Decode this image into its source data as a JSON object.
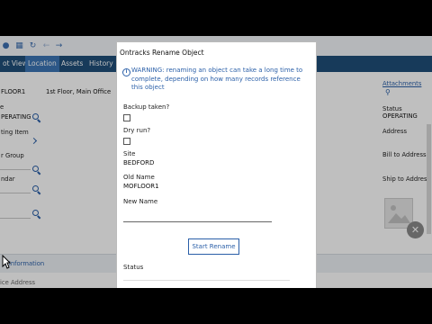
{
  "toolbar": {
    "icons": [
      "add-icon",
      "grid-icon",
      "copy-icon",
      "refresh-icon",
      "back-arrow-icon",
      "forward-arrow-icon"
    ]
  },
  "tabs": [
    {
      "label": "ot View",
      "active": false
    },
    {
      "label": "Location",
      "active": true
    },
    {
      "label": "Assets",
      "active": false
    },
    {
      "label": "History",
      "active": false
    }
  ],
  "left": {
    "location_value": "FLOOR1",
    "description_value": "1st Floor, Main Office",
    "type_label": "e",
    "status_value": "PERATING",
    "costing_label": "ting Item",
    "group_label": "r Group",
    "calendar_label": "ndar",
    "info_section": "t Information",
    "address_label": "ice Address"
  },
  "right": {
    "attachments_label": "Attachments",
    "status_label": "Status",
    "status_value": "OPERATING",
    "address_label": "Address",
    "bill_to_label": "Bill to Address",
    "ship_to_label": "Ship to Address"
  },
  "dialog": {
    "title": "Ontracks Rename Object",
    "warning": "WARNING: renaming an object can take a long time to complete, depending on how many records reference this object",
    "backup_label": "Backup taken?",
    "dry_run_label": "Dry run?",
    "site_label": "Site",
    "site_value": "BEDFORD",
    "old_name_label": "Old Name",
    "old_name_value": "MOFLOOR1",
    "new_name_label": "New Name",
    "new_name_value": "",
    "start_button": "Start Rename",
    "status_label": "Status"
  }
}
